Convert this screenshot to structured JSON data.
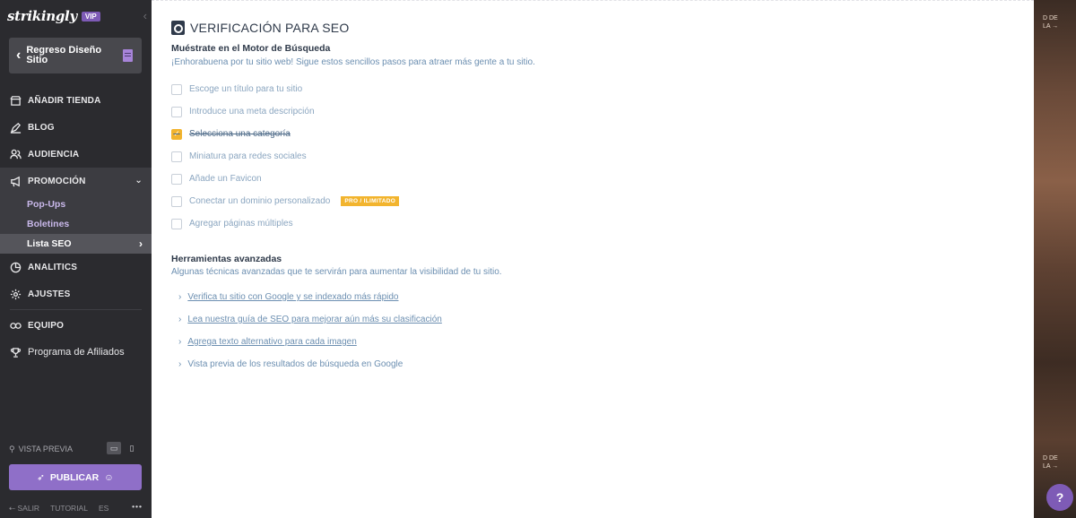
{
  "sidebar": {
    "brand": "strikingly",
    "vip": "VIP",
    "back_label": "Regreso Diseño Sitio",
    "nav": {
      "add_store": "AÑADIR TIENDA",
      "blog": "BLOG",
      "audience": "AUDIENCIA",
      "promotion": "PROMOCIÓN",
      "sub": [
        "Pop-Ups",
        "Boletines",
        "Lista SEO"
      ],
      "analytics": "ANALITICS",
      "settings": "AJUSTES",
      "team": "EQUIPO",
      "affiliates": "Programa de Afiliados"
    },
    "preview": "VISTA PREVIA",
    "publish": "PUBLICAR",
    "footer": {
      "exit": "SALIR",
      "tutorial": "TUTORIAL",
      "lang": "ES",
      "more": "•••"
    }
  },
  "main": {
    "title": "VERIFICACIÓN PARA SEO",
    "section1": {
      "title": "Muéstrate en el Motor de Búsqueda",
      "subtitle": "¡Enhorabuena por tu sitio web! Sigue estos sencillos pasos para atraer más gente a tu sitio.",
      "items": [
        {
          "label": "Escoge un título para tu sitio",
          "checked": false
        },
        {
          "label": "Introduce una meta descripción",
          "checked": false
        },
        {
          "label": "Selecciona una categoría",
          "checked": true
        },
        {
          "label": "Miniatura para redes sociales",
          "checked": false
        },
        {
          "label": "Añade un Favicon",
          "checked": false
        },
        {
          "label": "Conectar un dominio personalizado",
          "checked": false,
          "badge": "PRO / ILIMITADO"
        },
        {
          "label": "Agregar páginas múltiples",
          "checked": false
        }
      ]
    },
    "section2": {
      "title": "Herramientas avanzadas",
      "subtitle": "Algunas técnicas avanzadas que te servirán para aumentar la visibilidad de tu sitio.",
      "links": [
        "Verifica tu sitio con Google y se indexado más rápido",
        "Lea nuestra guía de SEO para mejorar aún más su clasificación",
        "Agrega texto alternativo para cada imagen",
        "Vista previa de los resultados de búsqueda en Google"
      ]
    }
  },
  "preview_strip": {
    "text_top": "D DE\nLA →",
    "text_bottom": "D DE\nLA →",
    "help": "?"
  },
  "colors": {
    "sidebar_bg": "#2b2b2f",
    "accent_purple": "#8f6fc8",
    "check_yellow": "#f2b42e",
    "link_blue": "#6c8fb1"
  }
}
